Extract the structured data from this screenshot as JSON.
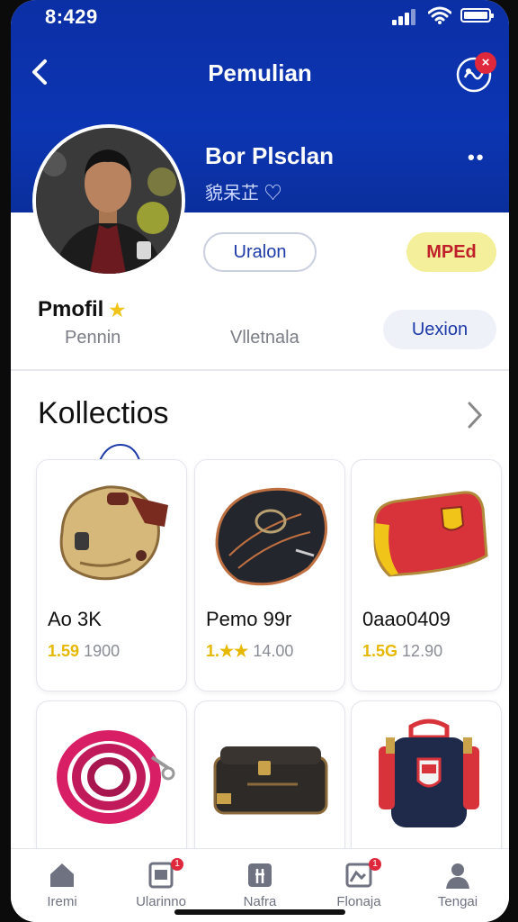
{
  "status_bar": {
    "time": "8:429"
  },
  "header": {
    "title": "Pemulian",
    "notification_count": "×"
  },
  "profile": {
    "name": "Bor Plsclan",
    "subname": "貌呆芷 ♡",
    "button_outline": "Uralon",
    "button_yellow": "MPEd",
    "section_label": "Pmofil",
    "stat_left": "Pennin",
    "stat_right": "Vlletnala",
    "button_version": "Uexion"
  },
  "collections": {
    "title": "Kollectios",
    "items": [
      {
        "name": "Ao 3K",
        "rating": "1.59",
        "price": "1900",
        "icon": "glove-tan-icon"
      },
      {
        "name": "Pemo 99r",
        "rating": "1.★★",
        "price": "14.00",
        "icon": "glove-black-icon"
      },
      {
        "name": "0aao0409",
        "rating": "1.5G",
        "price": "12.90",
        "icon": "wallet-red-icon"
      },
      {
        "name": "",
        "rating": "",
        "price": "",
        "icon": "pink-rope-icon"
      },
      {
        "name": "",
        "rating": "",
        "price": "",
        "icon": "suitcase-icon"
      },
      {
        "name": "",
        "rating": "",
        "price": "",
        "icon": "backpack-icon"
      }
    ]
  },
  "bottom_nav": {
    "items": [
      {
        "label": "Iremi",
        "icon": "home-icon"
      },
      {
        "label": "Ularinno",
        "icon": "document-icon"
      },
      {
        "label": "Nafra",
        "icon": "shop-icon"
      },
      {
        "label": "Flonaja",
        "icon": "inbox-icon"
      },
      {
        "label": "Tengai",
        "icon": "profile-icon"
      }
    ]
  },
  "colors": {
    "header_blue": "#0c35b3",
    "accent_yellow": "#f3ef9a",
    "alert_red": "#e0283c"
  }
}
